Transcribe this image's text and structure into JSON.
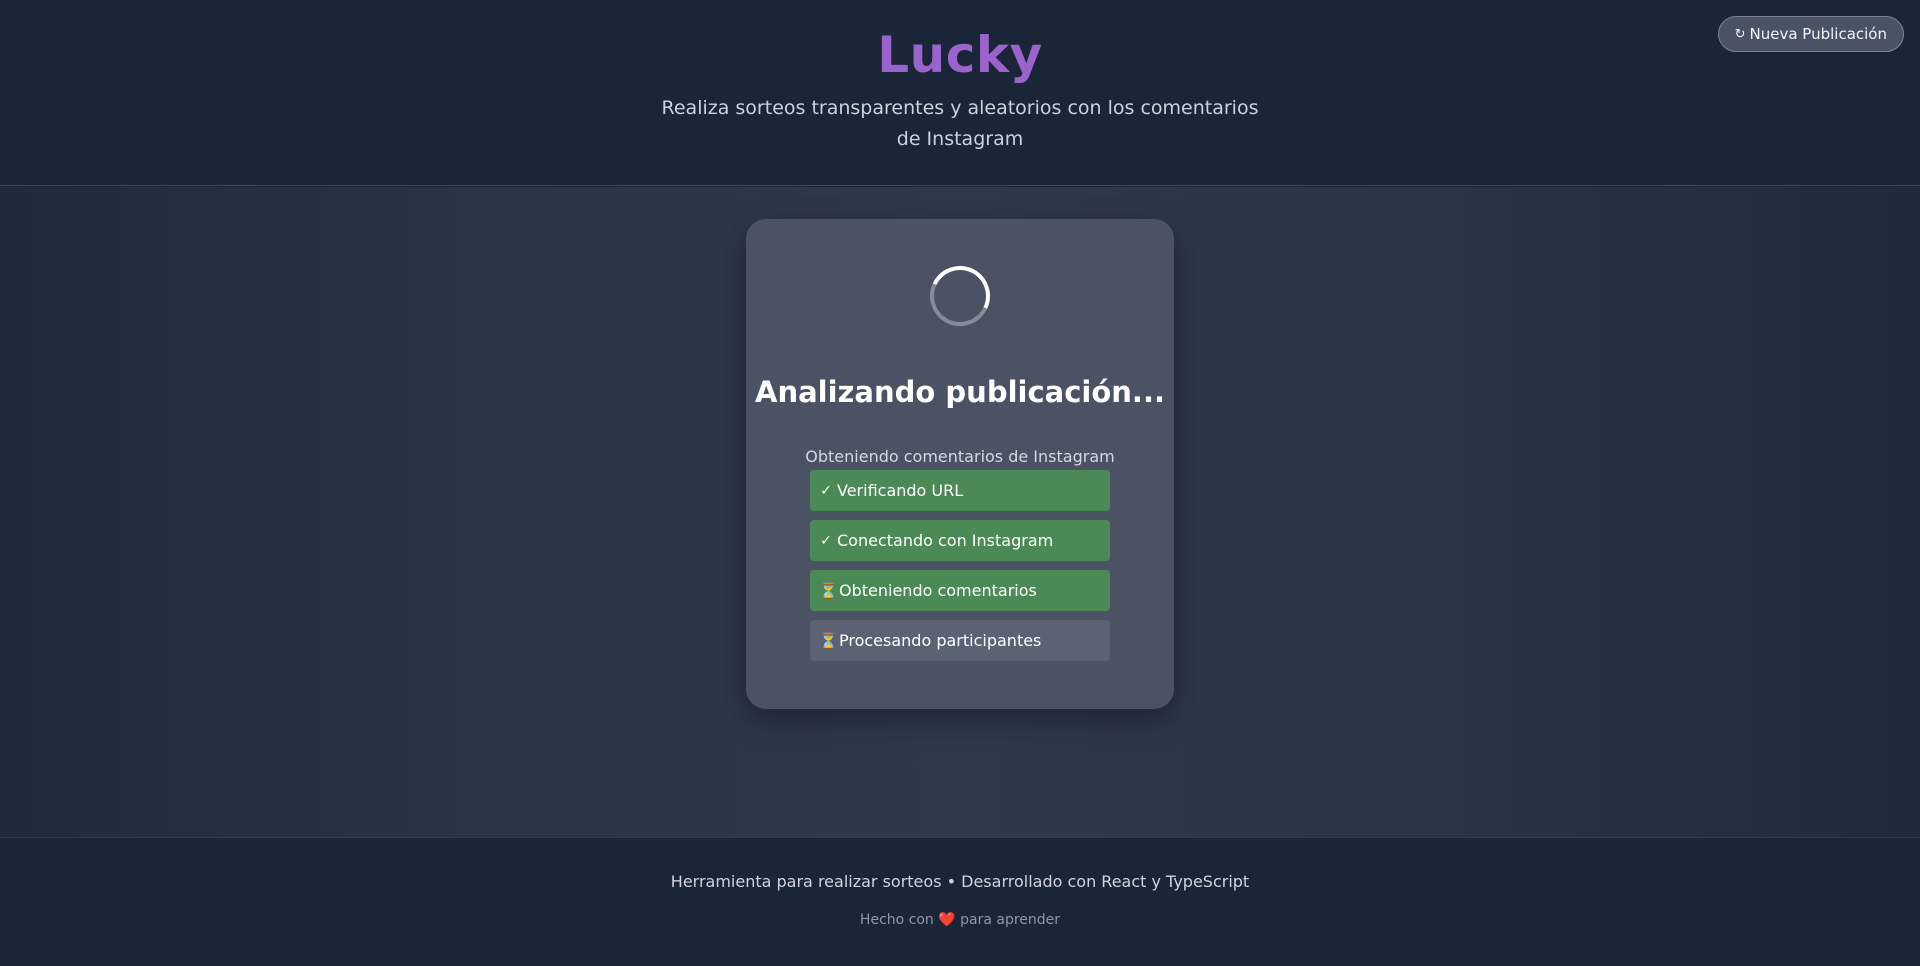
{
  "header": {
    "new_publication_icon": "↻",
    "new_publication_label": "Nueva Publicación",
    "brand": "Lucky",
    "tagline": "Realiza sorteos transparentes y aleatorios con los comentarios de Instagram"
  },
  "card": {
    "title": "Analizando publicación...",
    "subtitle": "Obteniendo comentarios de Instagram",
    "steps": [
      {
        "icon": "✓",
        "label": "Verificando URL",
        "status": "done"
      },
      {
        "icon": "✓",
        "label": "Conectando con Instagram",
        "status": "done"
      },
      {
        "icon": "⏳",
        "label": "Obteniendo comentarios",
        "status": "active"
      },
      {
        "icon": "⏳",
        "label": "Procesando participantes",
        "status": "pending"
      }
    ]
  },
  "footer": {
    "line1": "Herramienta para realizar sorteos • Desarrollado con React y TypeScript",
    "line2_before": "Hecho con",
    "line2_heart": "❤️",
    "line2_after": "para aprender"
  },
  "colors": {
    "brand": "#9b63cc",
    "step_done": "#4b8a56",
    "step_pending": "#5b6274"
  }
}
